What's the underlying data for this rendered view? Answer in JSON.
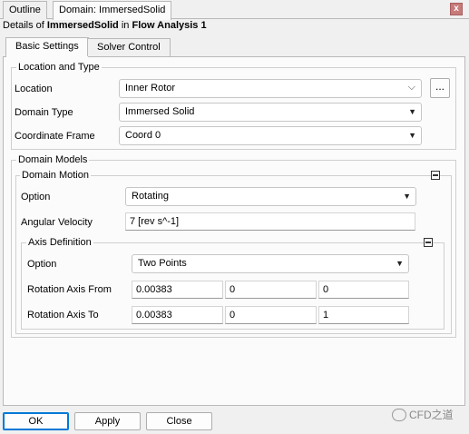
{
  "top_tabs": [
    {
      "label": "Outline"
    },
    {
      "label": "Domain: ImmersedSolid"
    }
  ],
  "close_label": "x",
  "details": {
    "prefix": "Details of ",
    "object": "ImmersedSolid",
    "mid": " in ",
    "analysis": "Flow Analysis 1"
  },
  "inner_tabs": [
    {
      "label": "Basic Settings"
    },
    {
      "label": "Solver Control"
    }
  ],
  "location_and_type": {
    "title": "Location and Type",
    "location_label": "Location",
    "location_value": "Inner Rotor",
    "browse_label": "...",
    "domain_type_label": "Domain Type",
    "domain_type_value": "Immersed Solid",
    "coord_frame_label": "Coordinate Frame",
    "coord_frame_value": "Coord 0"
  },
  "domain_models": {
    "title": "Domain Models",
    "domain_motion": {
      "title": "Domain Motion",
      "option_label": "Option",
      "option_value": "Rotating",
      "angular_velocity_label": "Angular Velocity",
      "angular_velocity_value": "7 [rev s^-1]",
      "axis_definition": {
        "title": "Axis Definition",
        "option_label": "Option",
        "option_value": "Two Points",
        "from_label": "Rotation Axis From",
        "from_values": [
          "0.00383",
          "0",
          "0"
        ],
        "to_label": "Rotation Axis To",
        "to_values": [
          "0.00383",
          "0",
          "1"
        ]
      }
    }
  },
  "buttons": {
    "ok": "OK",
    "apply": "Apply",
    "close": "Close"
  },
  "watermark": "CFD之道",
  "colors": {
    "ok_border": "#0078d7",
    "close_icon_bg": "#c77a7a"
  }
}
